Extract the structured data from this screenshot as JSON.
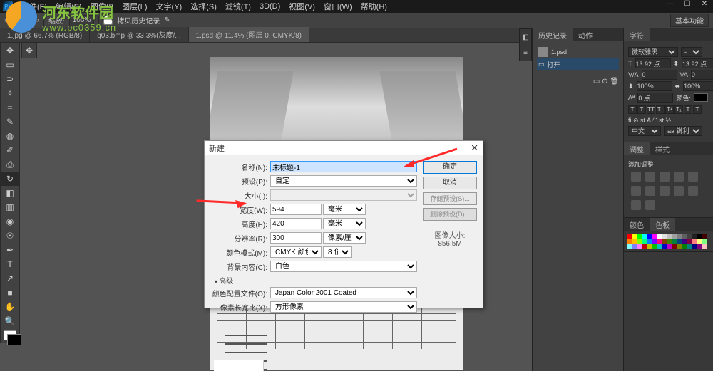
{
  "watermark": {
    "cn": "河东软件园",
    "url": "www.pc0359.cn"
  },
  "menubar": {
    "items": [
      "文件(F)",
      "编辑(E)",
      "图像(I)",
      "图层(L)",
      "文字(Y)",
      "选择(S)",
      "滤镜(T)",
      "3D(D)",
      "视图(V)",
      "窗口(W)",
      "帮助(H)"
    ]
  },
  "optionsbar": {
    "zoom_label": "缩放:",
    "zoom_value": "100%",
    "history_label": "拷贝历史记录",
    "workspace": "基本功能"
  },
  "tabs": [
    {
      "label": "1.jpg @ 66.7% (RGB/8)",
      "active": false
    },
    {
      "label": "q03.bmp @ 33.3%(灰度/...",
      "active": false
    },
    {
      "label": "1.psd @ 11.4% (图层 0, CMYK/8)",
      "active": true
    }
  ],
  "dialog": {
    "title": "新建",
    "name_label": "名称(N):",
    "name_value": "未标题-1",
    "preset_label": "预设(P):",
    "preset_value": "自定",
    "size_label": "大小(I):",
    "width_label": "宽度(W):",
    "width_value": "594",
    "width_unit": "毫米",
    "height_label": "高度(H):",
    "height_value": "420",
    "height_unit": "毫米",
    "res_label": "分辨率(R):",
    "res_value": "300",
    "res_unit": "像素/厘米",
    "mode_label": "颜色模式(M):",
    "mode_value": "CMYK 颜色",
    "bits_value": "8 位",
    "bg_label": "背景内容(C):",
    "bg_value": "白色",
    "advanced": "高级",
    "profile_label": "颜色配置文件(O):",
    "profile_value": "Japan Color 2001 Coated",
    "aspect_label": "像素长宽比(X):",
    "aspect_value": "方形像素",
    "ok": "确定",
    "cancel": "取消",
    "save_preset": "存储预设(S)...",
    "delete_preset": "删除预设(D)...",
    "size_info_label": "图像大小:",
    "size_info_value": "856.5M"
  },
  "panels": {
    "history_tab": "历史记录",
    "actions_tab": "动作",
    "history_doc": "1.psd",
    "history_open": "打开",
    "char_tab": "字符",
    "char_font": "微软雅黑",
    "char_size": "13.92 点",
    "char_leading": "13.92 点",
    "char_tracking": "0",
    "char_vscale": "100%",
    "char_hscale": "100%",
    "char_baseline": "0 点",
    "char_color": "颜色:",
    "char_lang": "中文",
    "char_aa": "aa 锐利",
    "adjust_tab": "调整",
    "styles_tab": "样式",
    "adjust_hint": "添加调整",
    "swatch_tab1": "颜色",
    "swatch_tab2": "色板"
  },
  "swatch_colors": [
    "#ff0000",
    "#ffff00",
    "#00ff00",
    "#00ffff",
    "#0000ff",
    "#ff00ff",
    "#ffffff",
    "#e0e0e0",
    "#c0c0c0",
    "#a0a0a0",
    "#808080",
    "#606060",
    "#404040",
    "#202020",
    "#000000",
    "#400000",
    "#ff8000",
    "#ffc000",
    "#80ff00",
    "#00ff80",
    "#0080ff",
    "#8000ff",
    "#ff0080",
    "#804000",
    "#408000",
    "#008040",
    "#004080",
    "#400080",
    "#800040",
    "#ff8080",
    "#ffff80",
    "#80ff80",
    "#80ffff",
    "#8080ff",
    "#ff80ff",
    "#c00000",
    "#c0c000",
    "#00c000",
    "#00c0c0",
    "#0000c0",
    "#c000c0",
    "#800000",
    "#808000",
    "#008000",
    "#008080",
    "#000080",
    "#800080",
    "#ffc0c0"
  ]
}
